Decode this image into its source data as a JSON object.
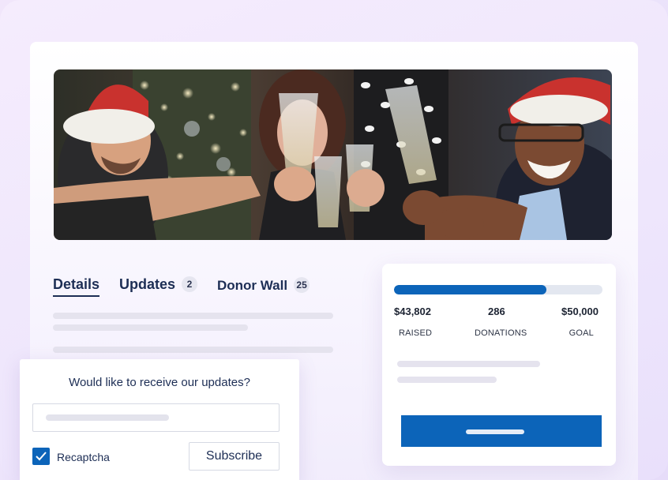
{
  "tabs": [
    {
      "label": "Details",
      "active": true
    },
    {
      "label": "Updates",
      "badge": "2"
    },
    {
      "label": "Donor Wall",
      "badge": "25"
    }
  ],
  "campaign": {
    "progress": 0.73,
    "raised_value": "$43,802",
    "raised_label": "RAISED",
    "donations_value": "286",
    "donations_label": "DONATIONS",
    "goal_value": "$50,000",
    "goal_label": "GOAL"
  },
  "subscribe": {
    "prompt": "Would like to receive our updates?",
    "recaptcha_label": "Recaptcha",
    "recaptcha_checked": true,
    "button_label": "Subscribe"
  },
  "colors": {
    "accent": "#0c64b9",
    "text_dark": "#1d2e55"
  },
  "icons": {
    "checkbox": "check-icon"
  }
}
